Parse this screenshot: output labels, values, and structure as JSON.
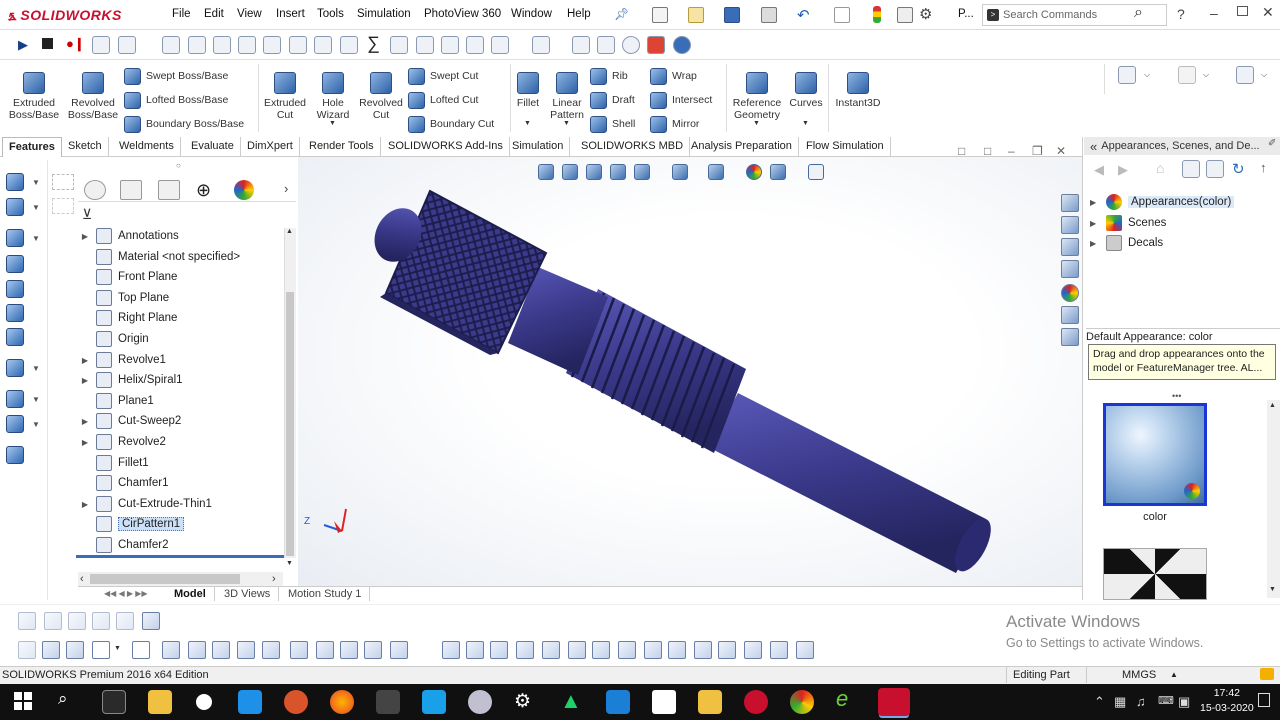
{
  "app": {
    "brand": "SOLIDWORKS",
    "brand_color": "#c8102e"
  },
  "menu": [
    "File",
    "Edit",
    "View",
    "Insert",
    "Tools",
    "Simulation",
    "PhotoView 360",
    "Window",
    "Help"
  ],
  "quick": {
    "pin_icon": "pin-icon",
    "more_label": "P..."
  },
  "search": {
    "placeholder": "Search Commands"
  },
  "command_manager": {
    "big": [
      {
        "label": "Extruded\nBoss/Base",
        "icon": "extruded-boss-icon"
      },
      {
        "label": "Revolved\nBoss/Base",
        "icon": "revolved-boss-icon"
      },
      {
        "label": "Extruded\nCut",
        "icon": "extruded-cut-icon"
      },
      {
        "label": "Hole\nWizard",
        "icon": "hole-wizard-icon"
      },
      {
        "label": "Revolved\nCut",
        "icon": "revolved-cut-icon"
      },
      {
        "label": "Fillet",
        "icon": "fillet-icon"
      },
      {
        "label": "Linear\nPattern",
        "icon": "linear-pattern-icon"
      },
      {
        "label": "Reference\nGeometry",
        "icon": "reference-geometry-icon"
      },
      {
        "label": "Curves",
        "icon": "curves-icon"
      },
      {
        "label": "Instant3D",
        "icon": "instant3d-icon"
      }
    ],
    "small_col1": [
      "Swept Boss/Base",
      "Lofted Boss/Base",
      "Boundary Boss/Base"
    ],
    "small_col2": [
      "Swept Cut",
      "Lofted Cut",
      "Boundary Cut"
    ],
    "small_col3": [
      "Rib",
      "Draft",
      "Shell"
    ],
    "small_col4": [
      "Wrap",
      "Intersect",
      "Mirror"
    ]
  },
  "tabs": [
    "Features",
    "Sketch",
    "Weldments",
    "Evaluate",
    "DimXpert",
    "Render Tools",
    "SOLIDWORKS Add-Ins",
    "Simulation",
    "SOLIDWORKS MBD",
    "Analysis Preparation",
    "Flow Simulation"
  ],
  "feature_tree": [
    {
      "label": "Annotations",
      "arrow": true
    },
    {
      "label": "Material <not specified>",
      "arrow": false
    },
    {
      "label": "Front Plane",
      "arrow": false
    },
    {
      "label": "Top Plane",
      "arrow": false
    },
    {
      "label": "Right Plane",
      "arrow": false
    },
    {
      "label": "Origin",
      "arrow": false
    },
    {
      "label": "Revolve1",
      "arrow": true
    },
    {
      "label": "Helix/Spiral1",
      "arrow": true
    },
    {
      "label": "Plane1",
      "arrow": false
    },
    {
      "label": "Cut-Sweep2",
      "arrow": true
    },
    {
      "label": "Revolve2",
      "arrow": true
    },
    {
      "label": "Fillet1",
      "arrow": false
    },
    {
      "label": "Chamfer1",
      "arrow": false
    },
    {
      "label": "Cut-Extrude-Thin1",
      "arrow": true
    },
    {
      "label": "CirPattern1",
      "arrow": false,
      "selected": true
    },
    {
      "label": "Chamfer2",
      "arrow": false
    }
  ],
  "model": {
    "color": "#3b3a8c",
    "dark": "#23235e",
    "triad_label": "Z"
  },
  "task_pane": {
    "title": "Appearances, Scenes, and De...",
    "items": [
      {
        "label": "Appearances(color)",
        "icon": "appearances-icon"
      },
      {
        "label": "Scenes",
        "icon": "scenes-icon"
      },
      {
        "label": "Decals",
        "icon": "decals-icon"
      }
    ],
    "section_title": "Default Appearance: color",
    "tooltip": "Drag and drop appearances onto the model or FeatureManager tree.  AL...",
    "swatch_label": "color"
  },
  "bottom_tabs": [
    "Model",
    "3D Views",
    "Motion Study 1"
  ],
  "watermark": {
    "line1": "Activate Windows",
    "line2": "Go to Settings to activate Windows."
  },
  "status": {
    "edition": "SOLIDWORKS Premium 2016 x64 Edition",
    "mode": "Editing Part",
    "units": "MMGS"
  },
  "clock": {
    "time": "17:42",
    "date": "15-03-2020"
  }
}
